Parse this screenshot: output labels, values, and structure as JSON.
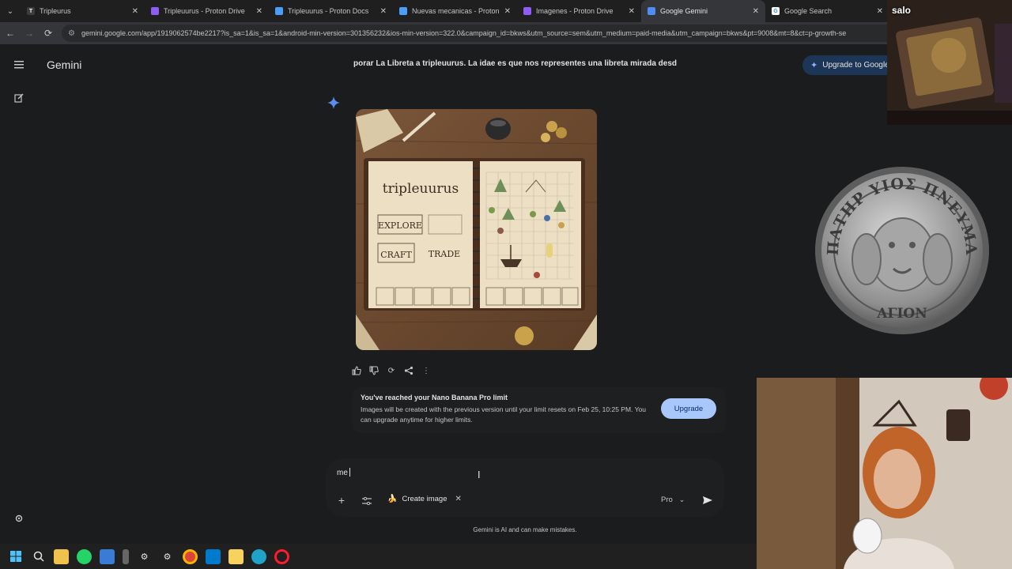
{
  "tabs": [
    {
      "title": "Tripleurus",
      "fav_letter": "T",
      "fav_color": "#3c3c3c",
      "active": false
    },
    {
      "title": "Tripleuurus - Proton Drive",
      "fav_letter": "",
      "fav_color": "#8f5cf7",
      "active": false
    },
    {
      "title": "Tripleuurus - Proton Docs",
      "fav_letter": "",
      "fav_color": "#4a9df8",
      "active": false
    },
    {
      "title": "Nuevas mecanicas - Proton Do",
      "fav_letter": "",
      "fav_color": "#4a9df8",
      "active": false
    },
    {
      "title": "Imagenes - Proton Drive",
      "fav_letter": "",
      "fav_color": "#8f5cf7",
      "active": false
    },
    {
      "title": "Google Gemini",
      "fav_letter": "",
      "fav_color": "#4c8df6",
      "active": true
    },
    {
      "title": "Google Search",
      "fav_letter": "G",
      "fav_color": "#ffffff",
      "active": false
    }
  ],
  "address": {
    "url": "gemini.google.com/app/1919062574be2217?is_sa=1&is_sa=1&android-min-version=301356232&ios-min-version=322.0&campaign_id=bkws&utm_source=sem&utm_medium=paid-media&utm_campaign=bkws&pt=9008&mt=8&ct=p-growth-se"
  },
  "app": {
    "title": "Gemini",
    "upgrade_top": "Upgrade to Google"
  },
  "conversation": {
    "user_message": "porar La Libreta a tripleuurus. La idae es que nos representes una libreta mirada desd",
    "image_text": {
      "title": "tripleuurus",
      "explore": "EXPLORE",
      "craft": "CRAFT",
      "trade": "TRADE"
    }
  },
  "limit_notice": {
    "title": "You've reached your Nano Banana Pro limit",
    "body": "Images will be created with the previous version until your limit resets on Feb 25, 10:25 PM. You can upgrade anytime for higher limits.",
    "button": "Upgrade"
  },
  "composer": {
    "input_value": "me",
    "chip_label": "Create image",
    "model": "Pro",
    "disclaimer": "Gemini is AI and can make mistakes."
  },
  "overlays": {
    "webcam_badge": "salo",
    "coin_top": "ΠΑΤΗΡ ΥΙΟΣ ΠΝΕΥΜΑ",
    "coin_bottom": "ΑΓΙΟΝ"
  },
  "colors": {
    "accent": "#a8c7fa",
    "surface": "#1e1f20",
    "background": "#1b1c1d"
  }
}
